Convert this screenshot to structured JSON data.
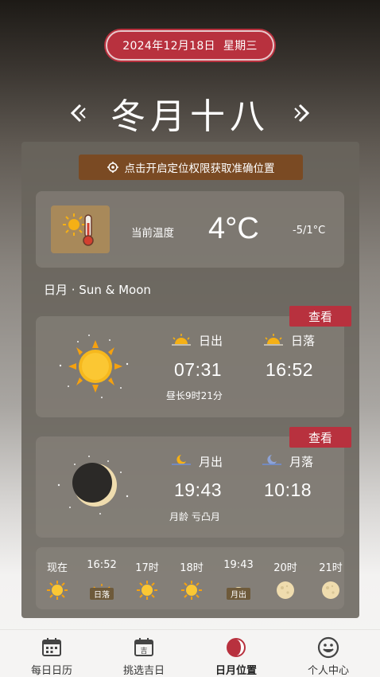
{
  "header": {
    "date": "2024年12月18日",
    "weekday": "星期三",
    "lunar_date": "冬月十八"
  },
  "location": {
    "button_label": "点击开启定位权限获取准确位置"
  },
  "temperature": {
    "label": "当前温度",
    "value": "4°C",
    "range": "-5/1°C"
  },
  "sun_moon": {
    "section_title": "日月 · Sun & Moon",
    "view_label": "查看",
    "sun": {
      "rise_label": "日出",
      "rise_time": "07:31",
      "set_label": "日落",
      "set_time": "16:52",
      "day_length": "昼长9时21分"
    },
    "moon": {
      "rise_label": "月出",
      "rise_time": "19:43",
      "set_label": "月落",
      "set_time": "10:18",
      "phase": "月龄 亏凸月"
    }
  },
  "hourly": [
    {
      "time": "现在",
      "icon": "sun-icon",
      "tag": ""
    },
    {
      "time": "16:52",
      "icon": "sunset-icon",
      "tag": "日落"
    },
    {
      "time": "17时",
      "icon": "sun-icon",
      "tag": ""
    },
    {
      "time": "18时",
      "icon": "sun-icon",
      "tag": ""
    },
    {
      "time": "19:43",
      "icon": "moonrise-icon",
      "tag": "月出"
    },
    {
      "time": "20时",
      "icon": "moon-icon",
      "tag": ""
    },
    {
      "time": "21时",
      "icon": "moon-icon",
      "tag": ""
    }
  ],
  "tabs": [
    {
      "label": "每日日历",
      "icon": "calendar-icon"
    },
    {
      "label": "挑选吉日",
      "icon": "lucky-day-icon"
    },
    {
      "label": "日月位置",
      "icon": "sun-moon-icon",
      "active": true
    },
    {
      "label": "个人中心",
      "icon": "profile-icon"
    }
  ],
  "colors": {
    "accent": "#b8313e",
    "location_btn": "#7a4a23",
    "sun": "#f5b015"
  }
}
